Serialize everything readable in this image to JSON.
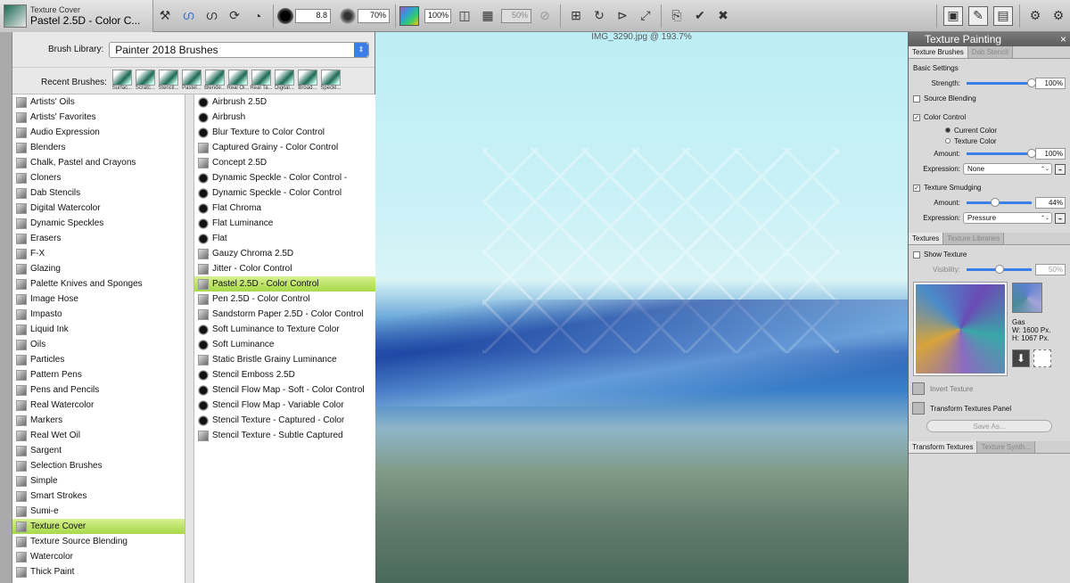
{
  "toolbar": {
    "brush_category": "Texture Cover",
    "brush_variant": "Pastel 2.5D - Color C...",
    "size": "8.8",
    "opacity": "70%",
    "grain": "100%",
    "grain2": "50%"
  },
  "library": {
    "label": "Brush Library:",
    "selected": "Painter 2018 Brushes",
    "recent_label": "Recent Brushes:",
    "recent": [
      "Surfac...",
      "Scratc...",
      "Stencil...",
      "Pastel...",
      "Blende...",
      "Real Oi...",
      "Real Ta...",
      "Digital...",
      "Broad...",
      "Speckl..."
    ]
  },
  "categories": [
    "Artists' Oils",
    "Artists' Favorites",
    "Audio Expression",
    "Blenders",
    "Chalk, Pastel and Crayons",
    "Cloners",
    "Dab Stencils",
    "Digital Watercolor",
    "Dynamic Speckles",
    "Erasers",
    "F-X",
    "Glazing",
    "Palette Knives and Sponges",
    "Image Hose",
    "Impasto",
    "Liquid Ink",
    "Oils",
    "Particles",
    "Pattern Pens",
    "Pens and Pencils",
    "Real Watercolor",
    "Markers",
    "Real Wet Oil",
    "Sargent",
    "Selection Brushes",
    "Simple",
    "Smart Strokes",
    "Sumi-e",
    "Texture Cover",
    "Texture Source Blending",
    "Watercolor",
    "Thick Paint"
  ],
  "selected_category": "Texture Cover",
  "variants": [
    "Airbrush 2.5D",
    "Airbrush",
    "Blur Texture to Color Control",
    "Captured Grainy - Color Control",
    "Concept 2.5D",
    "Dynamic Speckle - Color Control -",
    "Dynamic Speckle - Color Control",
    "Flat Chroma",
    "Flat Luminance",
    "Flat",
    "Gauzy Chroma 2.5D",
    "Jitter - Color Control",
    "Pastel 2.5D - Color Control",
    "Pen 2.5D - Color Control",
    "Sandstorm Paper 2.5D - Color Control",
    "Soft Luminance to Texture Color",
    "Soft Luminance",
    "Static Bristle Grainy Luminance",
    "Stencil Emboss 2.5D",
    "Stencil Flow Map - Soft - Color Control",
    "Stencil Flow Map - Variable Color",
    "Stencil Texture - Captured - Color",
    "Stencil Texture - Subtle Captured"
  ],
  "selected_variant": "Pastel 2.5D - Color Control",
  "canvas": {
    "title": "IMG_3290.jpg @ 193.7%"
  },
  "panel": {
    "title": "Texture Painting",
    "tab_brushes": "Texture Brushes",
    "tab_dab": "Dab Stencil",
    "basic": "Basic Settings",
    "strength_label": "Strength:",
    "strength": "100%",
    "strength_level": 1.0,
    "source_blending": "Source Blending",
    "color_control": "Color Control",
    "current_color": "Current Color",
    "texture_color": "Texture Color",
    "amount_label": "Amount:",
    "amount": "100%",
    "amount_level": 1.0,
    "expression_label": "Expression:",
    "expression": "None",
    "texture_smudging": "Texture Smudging",
    "amount2": "44%",
    "amount2_level": 0.44,
    "expression2": "Pressure",
    "tab_textures": "Textures",
    "tab_libraries": "Texture Libraries",
    "show_texture": "Show Texture",
    "visibility_label": "Visibility:",
    "visibility": "50%",
    "visibility_level": 0.5,
    "tex_name": "Gas",
    "tex_w": "W:  1600 Px.",
    "tex_h": "H:  1067 Px.",
    "invert": "Invert Texture",
    "transform_panel": "Transform Textures Panel",
    "save_as": "Save As...",
    "tab_transform": "Transform Textures",
    "tab_synth": "Texture Synth..."
  }
}
